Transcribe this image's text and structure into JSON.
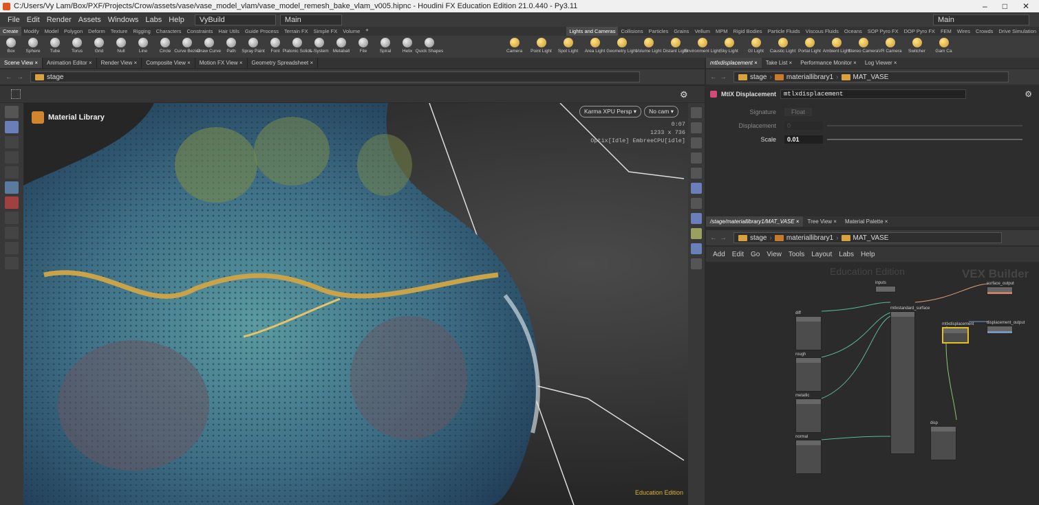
{
  "title": "C:/Users/Vy Lam/Box/PXF/Projects/Crow/assets/vase/vase_model_vlam/vase_model_remesh_bake_vlam_v005.hipnc - Houdini FX Education Edition 21.0.440 - Py3.11",
  "menu": [
    "File",
    "Edit",
    "Render",
    "Assets",
    "Windows",
    "Labs",
    "Help"
  ],
  "desktop": "VyBuild",
  "tasks": "Main",
  "desktop_right": "Main",
  "shelf_tabs_left": [
    "Create",
    "Modify",
    "Model",
    "Polygon",
    "Deform",
    "Texture",
    "Rigging",
    "Characters",
    "Constraints",
    "Hair Utils",
    "Guide Process",
    "Terrain FX",
    "Simple FX",
    "Volume"
  ],
  "shelf_tabs_right": [
    "Lights and Cameras",
    "Collisions",
    "Particles",
    "Grains",
    "Vellum",
    "MPM",
    "Rigid Bodies",
    "Particle Fluids",
    "Viscous Fluids",
    "Oceans",
    "SOP Pyro FX",
    "DOP Pyro FX",
    "FEM",
    "Wires",
    "Crowds",
    "Drive Simulation"
  ],
  "tools_left": [
    "Box",
    "Sphere",
    "Tube",
    "Torus",
    "Grid",
    "Null",
    "Line",
    "Circle",
    "Curve Bezier",
    "Draw Curve",
    "Path",
    "Spray Paint",
    "Font",
    "Platonic Solids",
    "L-System",
    "Metaball",
    "File",
    "Spiral",
    "Helix",
    "Quick Shapes"
  ],
  "tools_right": [
    "Camera",
    "Point Light",
    "Spot Light",
    "Area Light",
    "Geometry Light",
    "Volume Light",
    "Distant Light",
    "Environment Light",
    "Sky Light",
    "GI Light",
    "Caustic Light",
    "Portal Light",
    "Ambient Light",
    "Stereo Camera",
    "VR Camera",
    "Switcher",
    "Gam Ca"
  ],
  "pane_tabs": [
    "Scene View",
    "Animation Editor",
    "Render View",
    "Composite View",
    "Motion FX View",
    "Geometry Spreadsheet"
  ],
  "path_left": "stage",
  "viewport": {
    "label": "Material Library",
    "renderer": "Karma XPU Persp ▾",
    "camera": "No cam ▾",
    "time": "0:07",
    "res": "1233 x 736",
    "status": "Optix[Idle] EmbreeCPU[idle]",
    "edu": "Education Edition"
  },
  "right_tabs": [
    "mtlxdisplacement",
    "Take List",
    "Performance Monitor",
    "Log Viewer"
  ],
  "right_path": [
    "stage",
    "materiallibrary1",
    "MAT_VASE"
  ],
  "node_type": "MtlX Displacement",
  "node_name": "mtlxdisplacement",
  "params": {
    "signature_label": "Signature",
    "signature": "Float",
    "disp_label": "Displacement",
    "disp": "0",
    "scale_label": "Scale",
    "scale": "0.01"
  },
  "net_tabs": [
    "/stage/materiallibrary1/MAT_VASE",
    "Tree View",
    "Material Palette"
  ],
  "net_menu": [
    "Add",
    "Edit",
    "Go",
    "View",
    "Tools",
    "Layout",
    "Labs",
    "Help"
  ],
  "net_watermark": "Education Edition",
  "net_context": "VEX Builder",
  "nodes": {
    "inputs": "inputs",
    "surface_output": "surface_output",
    "diff": "diff",
    "rough": "rough",
    "metallic": "metallic",
    "normal": "normal",
    "std": "mtlxstandard_surface",
    "mdisp": "mtlxdisplacement",
    "dispout": "displacement_output",
    "disp": "disp"
  }
}
